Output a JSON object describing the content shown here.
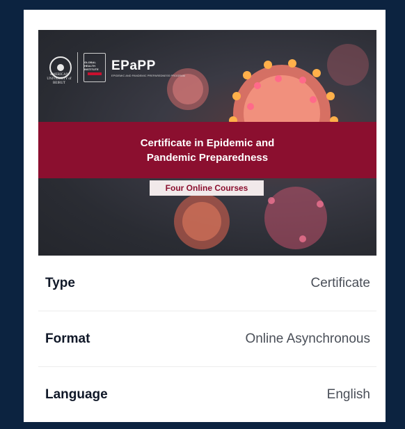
{
  "card": {
    "hero": {
      "university_logo_text": "AMERICAN UNIVERSITY of BEIRUT",
      "institute_logo_text": "GLOBAL HEALTH INSTITUTE",
      "program_acronym": "EPaPP",
      "program_fullname": "EPIDEMIC AND PANDEMIC PREPAREDNESS PROGRAM",
      "banner_line1": "Certificate in Epidemic and",
      "banner_line2": "Pandemic Preparedness",
      "pill": "Four Online Courses",
      "accent_color": "#8b0f2f"
    },
    "details": [
      {
        "label": "Type",
        "value": "Certificate"
      },
      {
        "label": "Format",
        "value": "Online Asynchronous"
      },
      {
        "label": "Language",
        "value": "English"
      }
    ]
  }
}
